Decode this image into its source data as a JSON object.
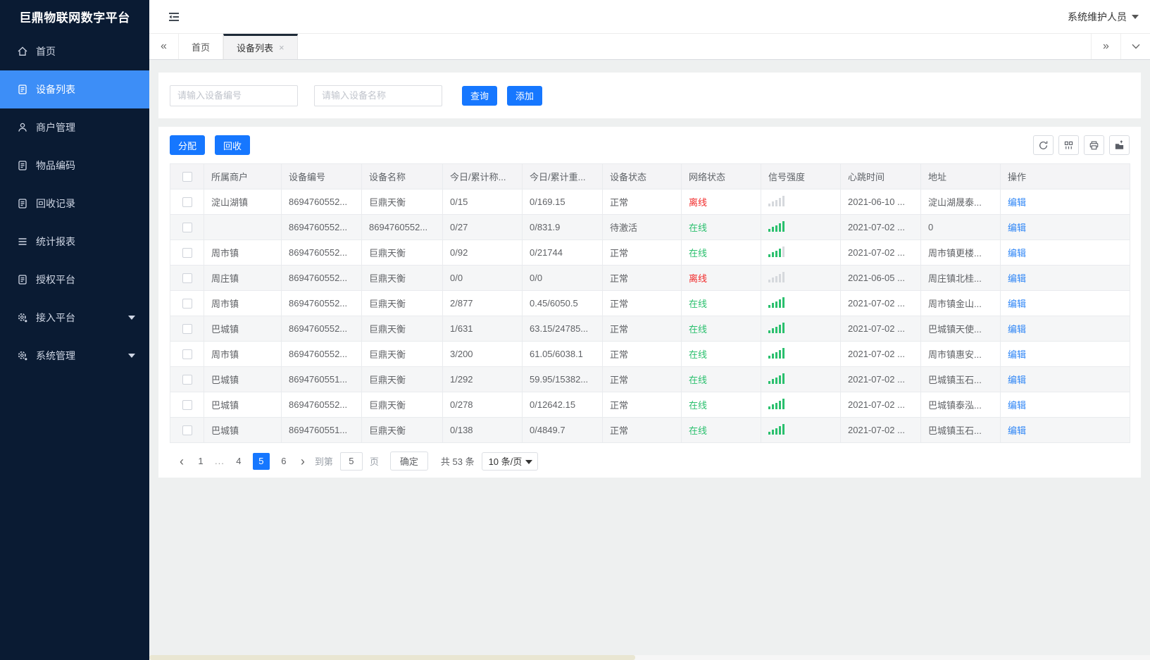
{
  "app": {
    "title": "巨鼎物联网数字平台",
    "user": "系统维护人员"
  },
  "colors": {
    "accent": "#1677ff",
    "sidebar_bg": "#0a1b33",
    "sidebar_active": "#3d8ef7",
    "online": "#2bc06e",
    "offline": "#f12b2b",
    "link": "#2f86f6"
  },
  "icons": {
    "tabs_scroll_left": "«",
    "tabs_scroll_right": "»",
    "tab_close": "×",
    "page_prev": "‹",
    "page_next": "›"
  },
  "sidebar": {
    "items": [
      {
        "label": "首页"
      },
      {
        "label": "设备列表"
      },
      {
        "label": "商户管理"
      },
      {
        "label": "物品编码"
      },
      {
        "label": "回收记录"
      },
      {
        "label": "统计报表"
      },
      {
        "label": "授权平台"
      },
      {
        "label": "接入平台"
      },
      {
        "label": "系统管理"
      }
    ]
  },
  "tabs": {
    "items": [
      {
        "label": "首页"
      },
      {
        "label": "设备列表"
      }
    ]
  },
  "search": {
    "device_no_placeholder": "请输入设备编号",
    "device_name_placeholder": "请输入设备名称",
    "query_label": "查询",
    "add_label": "添加"
  },
  "toolbar": {
    "assign_label": "分配",
    "recycle_label": "回收"
  },
  "table": {
    "headers": [
      "所属商户",
      "设备编号",
      "设备名称",
      "今日/累计称...",
      "今日/累计重...",
      "设备状态",
      "网络状态",
      "信号强度",
      "心跳时间",
      "地址",
      "操作"
    ],
    "edit_label": "编辑",
    "rows": [
      {
        "merchant": "淀山湖镇",
        "device_no": "8694760552...",
        "device_name": "巨鼎天衡",
        "today_count": "0/15",
        "today_weight": "0/169.15",
        "status": "正常",
        "network": "离线",
        "network_state": "offline",
        "signal_level": 0,
        "heartbeat": "2021-06-10 ...",
        "address": "淀山湖晟泰..."
      },
      {
        "merchant": "",
        "device_no": "8694760552...",
        "device_name": "8694760552...",
        "today_count": "0/27",
        "today_weight": "0/831.9",
        "status": "待激活",
        "network": "在线",
        "network_state": "online",
        "signal_level": 5,
        "heartbeat": "2021-07-02 ...",
        "address": "0"
      },
      {
        "merchant": "周市镇",
        "device_no": "8694760552...",
        "device_name": "巨鼎天衡",
        "today_count": "0/92",
        "today_weight": "0/21744",
        "status": "正常",
        "network": "在线",
        "network_state": "online",
        "signal_level": 4,
        "heartbeat": "2021-07-02 ...",
        "address": "周市镇更楼..."
      },
      {
        "merchant": "周庄镇",
        "device_no": "8694760552...",
        "device_name": "巨鼎天衡",
        "today_count": "0/0",
        "today_weight": "0/0",
        "status": "正常",
        "network": "离线",
        "network_state": "offline",
        "signal_level": 0,
        "heartbeat": "2021-06-05 ...",
        "address": "周庄镇北桂..."
      },
      {
        "merchant": "周市镇",
        "device_no": "8694760552...",
        "device_name": "巨鼎天衡",
        "today_count": "2/877",
        "today_weight": "0.45/6050.5",
        "status": "正常",
        "network": "在线",
        "network_state": "online",
        "signal_level": 5,
        "heartbeat": "2021-07-02 ...",
        "address": "周市镇金山..."
      },
      {
        "merchant": "巴城镇",
        "device_no": "8694760552...",
        "device_name": "巨鼎天衡",
        "today_count": "1/631",
        "today_weight": "63.15/24785...",
        "status": "正常",
        "network": "在线",
        "network_state": "online",
        "signal_level": 5,
        "heartbeat": "2021-07-02 ...",
        "address": "巴城镇天使..."
      },
      {
        "merchant": "周市镇",
        "device_no": "8694760552...",
        "device_name": "巨鼎天衡",
        "today_count": "3/200",
        "today_weight": "61.05/6038.1",
        "status": "正常",
        "network": "在线",
        "network_state": "online",
        "signal_level": 5,
        "heartbeat": "2021-07-02 ...",
        "address": "周市镇惠安..."
      },
      {
        "merchant": "巴城镇",
        "device_no": "8694760551...",
        "device_name": "巨鼎天衡",
        "today_count": "1/292",
        "today_weight": "59.95/15382...",
        "status": "正常",
        "network": "在线",
        "network_state": "online",
        "signal_level": 5,
        "heartbeat": "2021-07-02 ...",
        "address": "巴城镇玉石..."
      },
      {
        "merchant": "巴城镇",
        "device_no": "8694760552...",
        "device_name": "巨鼎天衡",
        "today_count": "0/278",
        "today_weight": "0/12642.15",
        "status": "正常",
        "network": "在线",
        "network_state": "online",
        "signal_level": 5,
        "heartbeat": "2021-07-02 ...",
        "address": "巴城镇泰泓..."
      },
      {
        "merchant": "巴城镇",
        "device_no": "8694760551...",
        "device_name": "巨鼎天衡",
        "today_count": "0/138",
        "today_weight": "0/4849.7",
        "status": "正常",
        "network": "在线",
        "network_state": "online",
        "signal_level": 5,
        "heartbeat": "2021-07-02 ...",
        "address": "巴城镇玉石..."
      }
    ]
  },
  "pagination": {
    "pages": [
      "1",
      "...",
      "4",
      "5",
      "6"
    ],
    "current": "5",
    "goto_label": "到第",
    "goto_value": "5",
    "page_unit": "页",
    "confirm_label": "确定",
    "total_label": "共 53 条",
    "page_size": "10 条/页"
  }
}
